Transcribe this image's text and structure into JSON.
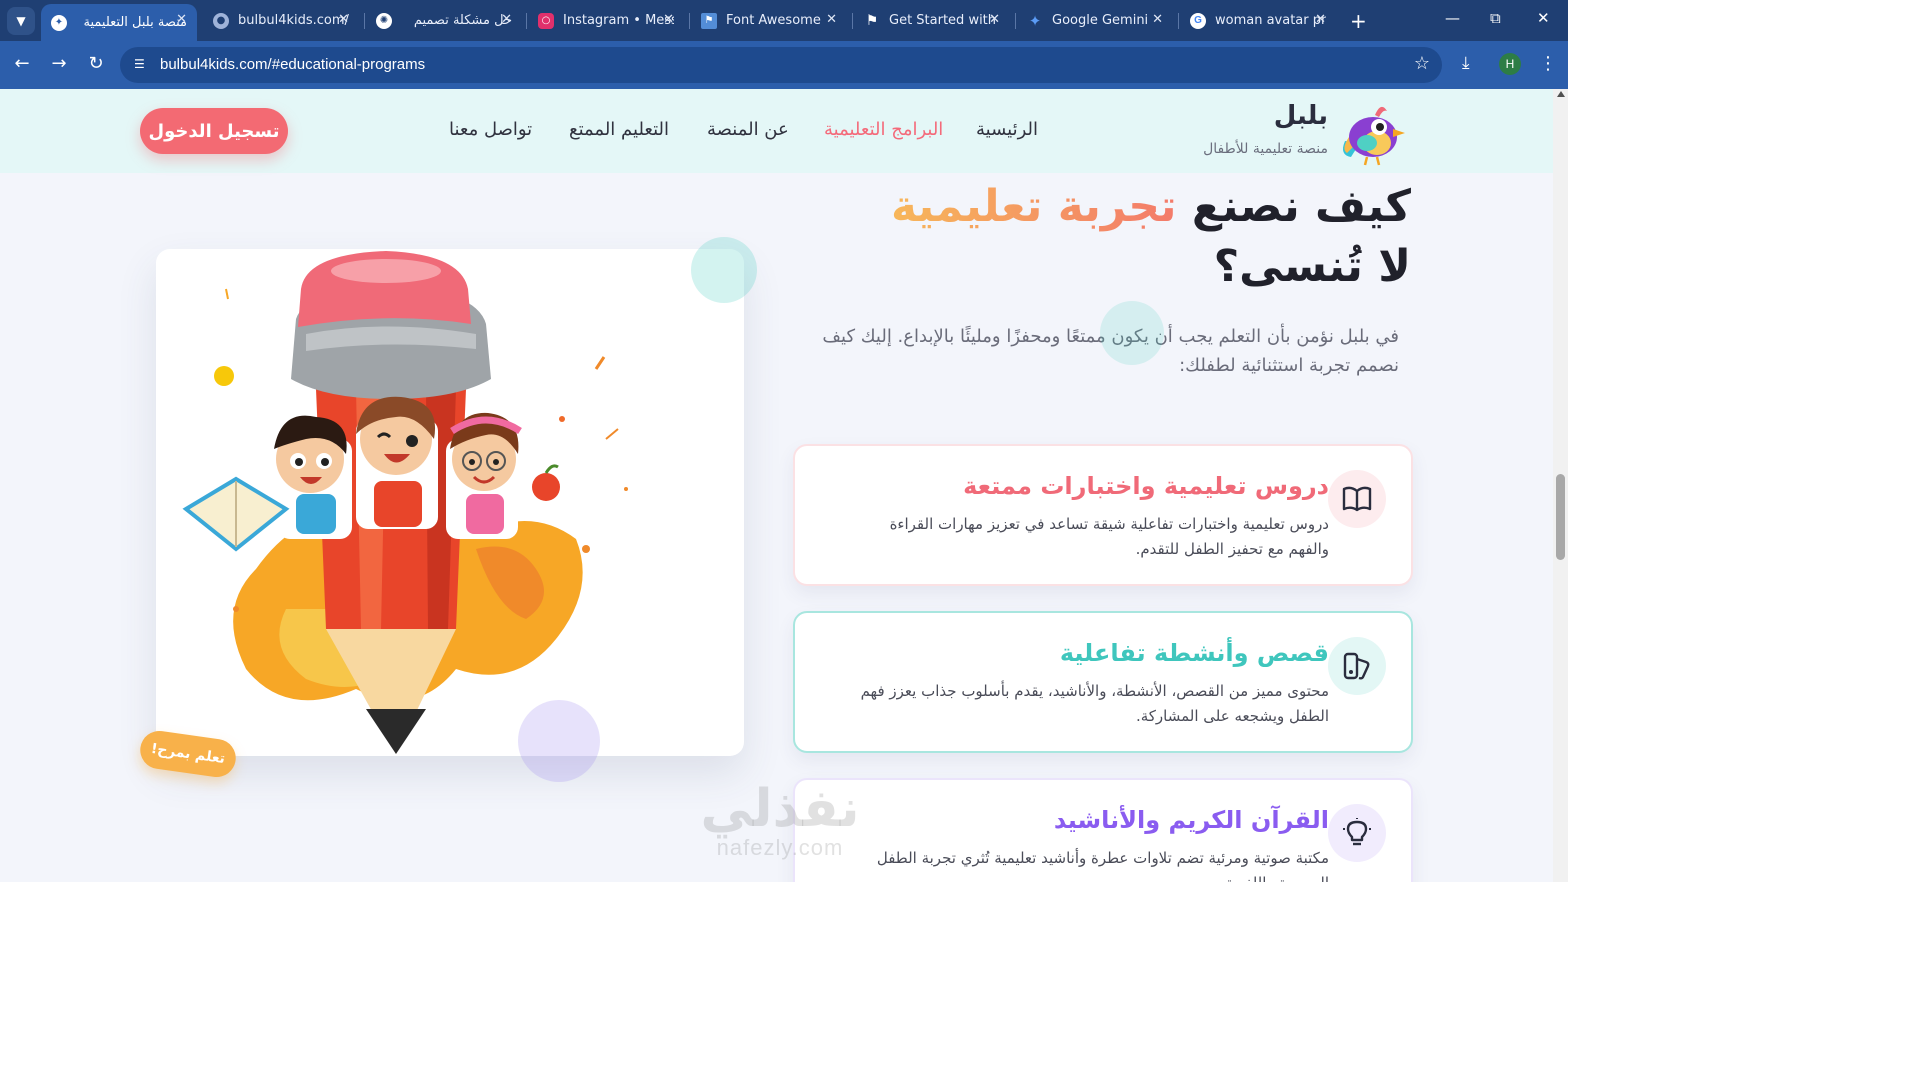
{
  "browser": {
    "tabs": [
      {
        "title": "منصة بلبل التعليمية",
        "active": true,
        "favicon": "bulbul-bird-icon",
        "color": "#ffffff"
      },
      {
        "title": "bulbul4kids.com/",
        "active": false,
        "favicon": "globe-icon",
        "color": "#9fb3d9"
      },
      {
        "title": "حل مشكلة تصميم",
        "active": false,
        "favicon": "chatgpt-icon",
        "color": "#ffffff"
      },
      {
        "title": "Instagram • Mess",
        "active": false,
        "favicon": "instagram-icon",
        "color": "#e1306c"
      },
      {
        "title": "Font Awesome",
        "active": false,
        "favicon": "font-awesome-flag-icon",
        "color": "#538dd7"
      },
      {
        "title": "Get Started with",
        "active": false,
        "favicon": "flag-icon",
        "color": "#ffffff"
      },
      {
        "title": "Google Gemini",
        "active": false,
        "favicon": "gemini-icon",
        "color": "#5b9cf6"
      },
      {
        "title": "woman avatar pn",
        "active": false,
        "favicon": "google-icon",
        "color": "#ffffff"
      }
    ],
    "url": "bulbul4kids.com/#educational-programs",
    "profile_initial": "H"
  },
  "site": {
    "brand": {
      "name": "بلبل",
      "tagline": "منصة تعليمية للأطفال"
    },
    "nav": [
      {
        "label": "الرئيسية",
        "active": false
      },
      {
        "label": "البرامج التعليمية",
        "active": true
      },
      {
        "label": "عن المنصة",
        "active": false
      },
      {
        "label": "التعليم الممتع",
        "active": false
      },
      {
        "label": "تواصل معنا",
        "active": false
      }
    ],
    "login_label": "تسجيل الدخول",
    "accent_color": "#f36a73"
  },
  "hero": {
    "title_part1": "كيف نصنع ",
    "title_highlight": "تجربة تعليمية",
    "title_part2": "لا تُنسى؟",
    "description": "في بلبل نؤمن بأن التعلم يجب أن يكون ممتعًا ومحفزًا ومليئًا بالإبداع. إليك كيف نصمم تجربة استثنائية لطفلك:",
    "badge": "تعلم بمرح!"
  },
  "features": [
    {
      "title": "دروس تعليمية واختبارات ممتعة",
      "description": "دروس تعليمية واختبارات تفاعلية شيقة تساعد في تعزيز مهارات القراءة والفهم مع تحفيز الطفل للتقدم.",
      "icon": "book-open-icon",
      "color": "#f06a78"
    },
    {
      "title": "قصص وأنشطة تفاعلية",
      "description": "محتوى مميز من القصص، الأنشطة، والأناشيد، يقدم بأسلوب جذاب يعزز فهم الطفل ويشجعه على المشاركة.",
      "icon": "palette-icon",
      "color": "#3fc6bd"
    },
    {
      "title": "القرآن الكريم والأناشيد",
      "description": "مكتبة صوتية ومرئية تضم تلاوات عطرة وأناشيد تعليمية تُثري تجربة الطفل السمعية واللغوية.",
      "icon": "lightbulb-icon",
      "color": "#8a5cf0"
    }
  ],
  "watermark": {
    "arabic": "نفذلي",
    "latin": "nafezly.com"
  }
}
